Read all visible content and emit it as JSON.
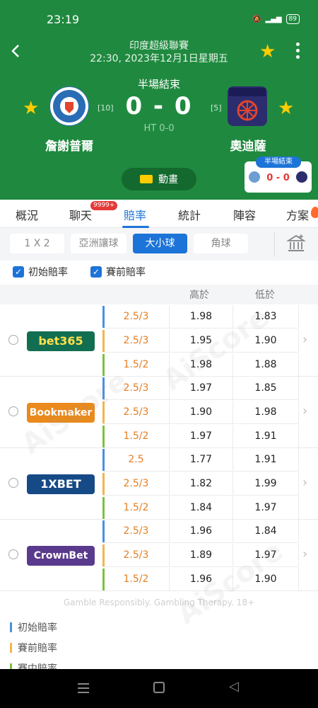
{
  "status_bar": {
    "time": "23:19",
    "battery": "89"
  },
  "header": {
    "league": "印度超級聯賽",
    "datetime": "22:30, 2023年12月1日星期五",
    "status": "半場結束",
    "score": "0 - 0",
    "ht_score": "HT 0-0",
    "home": {
      "name": "詹謝普爾",
      "rank": "[10]",
      "color": "#2a6db5"
    },
    "away": {
      "name": "奧迪薩",
      "rank": "[5]",
      "color": "#2b2d6e"
    },
    "animation_label": "動畫",
    "mini": {
      "label": "半場結束",
      "score": "0 - 0"
    }
  },
  "tabs": [
    {
      "label": "概況"
    },
    {
      "label": "聊天",
      "badge": "9999+"
    },
    {
      "label": "賠率"
    },
    {
      "label": "統計"
    },
    {
      "label": "陣容"
    },
    {
      "label": "方案"
    }
  ],
  "filters": [
    "1 X 2",
    "亞洲讓球",
    "大小球",
    "角球"
  ],
  "active_filter": "大小球",
  "checkboxes": [
    "初始賠率",
    "賽前賠率"
  ],
  "table_header": {
    "over": "高於",
    "under": "低於"
  },
  "bookmakers": [
    {
      "name": "bet365",
      "color": "#126e51",
      "text_color": "#ffe14d",
      "rows": [
        {
          "line": "2.5/3",
          "over": "1.98",
          "under": "1.83"
        },
        {
          "line": "2.5/3",
          "over": "1.95",
          "under": "1.90"
        },
        {
          "line": "1.5/2",
          "over": "1.98",
          "under": "1.88"
        }
      ]
    },
    {
      "name": "Bookmaker",
      "color": "#ea8a1c",
      "text_color": "#ffffff",
      "rows": [
        {
          "line": "2.5/3",
          "over": "1.97",
          "under": "1.85"
        },
        {
          "line": "2.5/3",
          "over": "1.90",
          "under": "1.98"
        },
        {
          "line": "1.5/2",
          "over": "1.97",
          "under": "1.91"
        }
      ]
    },
    {
      "name": "1XBET",
      "color": "#164a86",
      "text_color": "#ffffff",
      "rows": [
        {
          "line": "2.5",
          "over": "1.77",
          "under": "1.91"
        },
        {
          "line": "2.5/3",
          "over": "1.82",
          "under": "1.99"
        },
        {
          "line": "1.5/2",
          "over": "1.84",
          "under": "1.97"
        }
      ]
    },
    {
      "name": "CrownBet",
      "color": "#5a3a8c",
      "text_color": "#ffffff",
      "rows": [
        {
          "line": "2.5/3",
          "over": "1.96",
          "under": "1.84"
        },
        {
          "line": "2.5/3",
          "over": "1.89",
          "under": "1.97"
        },
        {
          "line": "1.5/2",
          "over": "1.96",
          "under": "1.90"
        }
      ]
    }
  ],
  "row_colors": [
    "#4a90e2",
    "#f5b54a",
    "#7cc142"
  ],
  "disclaimer": "Gamble Responsibly. Gambling Therapy. 18+",
  "legend": [
    {
      "label": "初始賠率",
      "color": "#4a90e2"
    },
    {
      "label": "賽前賠率",
      "color": "#f5b54a"
    },
    {
      "label": "賽中賠率",
      "color": "#7cc142"
    }
  ],
  "watermark": "AiScore"
}
